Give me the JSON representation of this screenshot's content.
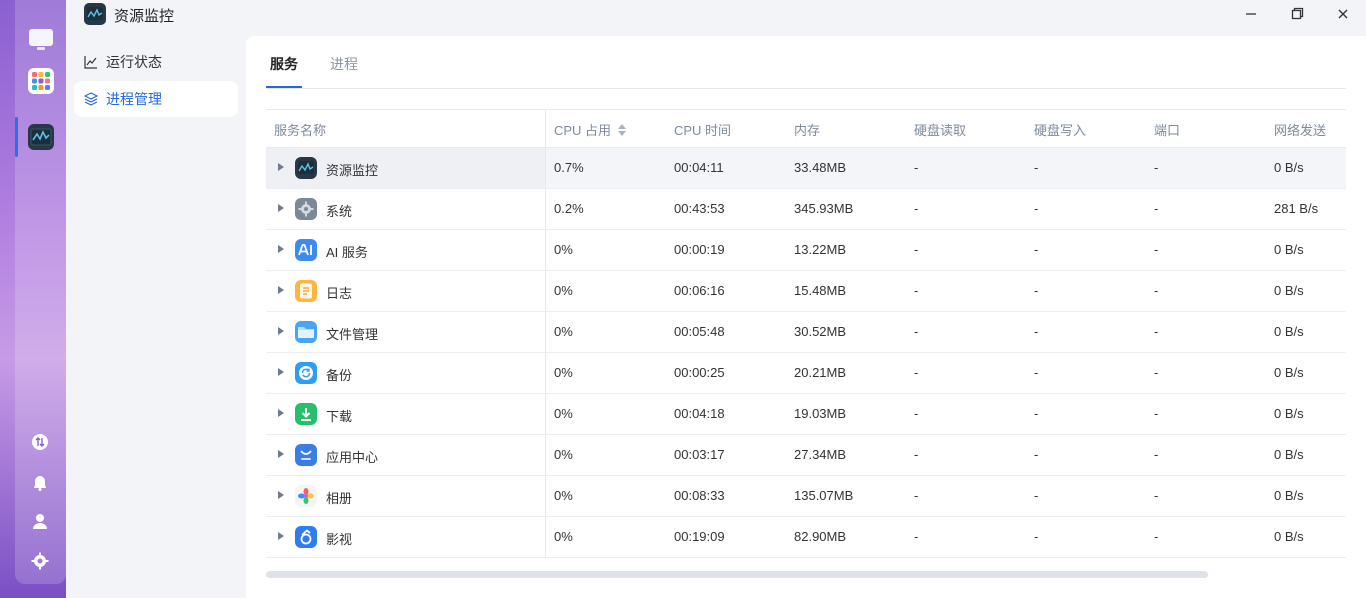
{
  "app": {
    "title": "资源监控"
  },
  "sidebar": {
    "items": [
      {
        "label": "运行状态",
        "icon": "line-chart-icon",
        "active": false
      },
      {
        "label": "进程管理",
        "icon": "layers-icon",
        "active": true
      }
    ]
  },
  "tabs": [
    {
      "label": "服务",
      "active": true
    },
    {
      "label": "进程",
      "active": false
    }
  ],
  "table": {
    "columns": {
      "name": "服务名称",
      "cpu": "CPU 占用",
      "cpu_time": "CPU 时间",
      "memory": "内存",
      "disk_read": "硬盘读取",
      "disk_write": "硬盘写入",
      "port": "端口",
      "net_send": "网络发送"
    },
    "rows": [
      {
        "name": "资源监控",
        "icon": "resource-monitor-icon",
        "cpu": "0.7%",
        "cpu_time": "00:04:11",
        "memory": "33.48MB",
        "disk_read": "-",
        "disk_write": "-",
        "port": "-",
        "net_send": "0 B/s"
      },
      {
        "name": "系统",
        "icon": "gear-icon",
        "cpu": "0.2%",
        "cpu_time": "00:43:53",
        "memory": "345.93MB",
        "disk_read": "-",
        "disk_write": "-",
        "port": "-",
        "net_send": "281 B/s"
      },
      {
        "name": "AI 服务",
        "icon": "ai-icon",
        "cpu": "0%",
        "cpu_time": "00:00:19",
        "memory": "13.22MB",
        "disk_read": "-",
        "disk_write": "-",
        "port": "-",
        "net_send": "0 B/s"
      },
      {
        "name": "日志",
        "icon": "log-icon",
        "cpu": "0%",
        "cpu_time": "00:06:16",
        "memory": "15.48MB",
        "disk_read": "-",
        "disk_write": "-",
        "port": "-",
        "net_send": "0 B/s"
      },
      {
        "name": "文件管理",
        "icon": "folder-icon",
        "cpu": "0%",
        "cpu_time": "00:05:48",
        "memory": "30.52MB",
        "disk_read": "-",
        "disk_write": "-",
        "port": "-",
        "net_send": "0 B/s"
      },
      {
        "name": "备份",
        "icon": "backup-icon",
        "cpu": "0%",
        "cpu_time": "00:00:25",
        "memory": "20.21MB",
        "disk_read": "-",
        "disk_write": "-",
        "port": "-",
        "net_send": "0 B/s"
      },
      {
        "name": "下载",
        "icon": "download-icon",
        "cpu": "0%",
        "cpu_time": "00:04:18",
        "memory": "19.03MB",
        "disk_read": "-",
        "disk_write": "-",
        "port": "-",
        "net_send": "0 B/s"
      },
      {
        "name": "应用中心",
        "icon": "app-center-icon",
        "cpu": "0%",
        "cpu_time": "00:03:17",
        "memory": "27.34MB",
        "disk_read": "-",
        "disk_write": "-",
        "port": "-",
        "net_send": "0 B/s"
      },
      {
        "name": "相册",
        "icon": "photos-icon",
        "cpu": "0%",
        "cpu_time": "00:08:33",
        "memory": "135.07MB",
        "disk_read": "-",
        "disk_write": "-",
        "port": "-",
        "net_send": "0 B/s"
      },
      {
        "name": "影视",
        "icon": "video-icon",
        "cpu": "0%",
        "cpu_time": "00:19:09",
        "memory": "82.90MB",
        "disk_read": "-",
        "disk_write": "-",
        "port": "-",
        "net_send": "0 B/s"
      }
    ]
  },
  "colors": {
    "accent": "#2468e0",
    "dock": "#a27add"
  }
}
